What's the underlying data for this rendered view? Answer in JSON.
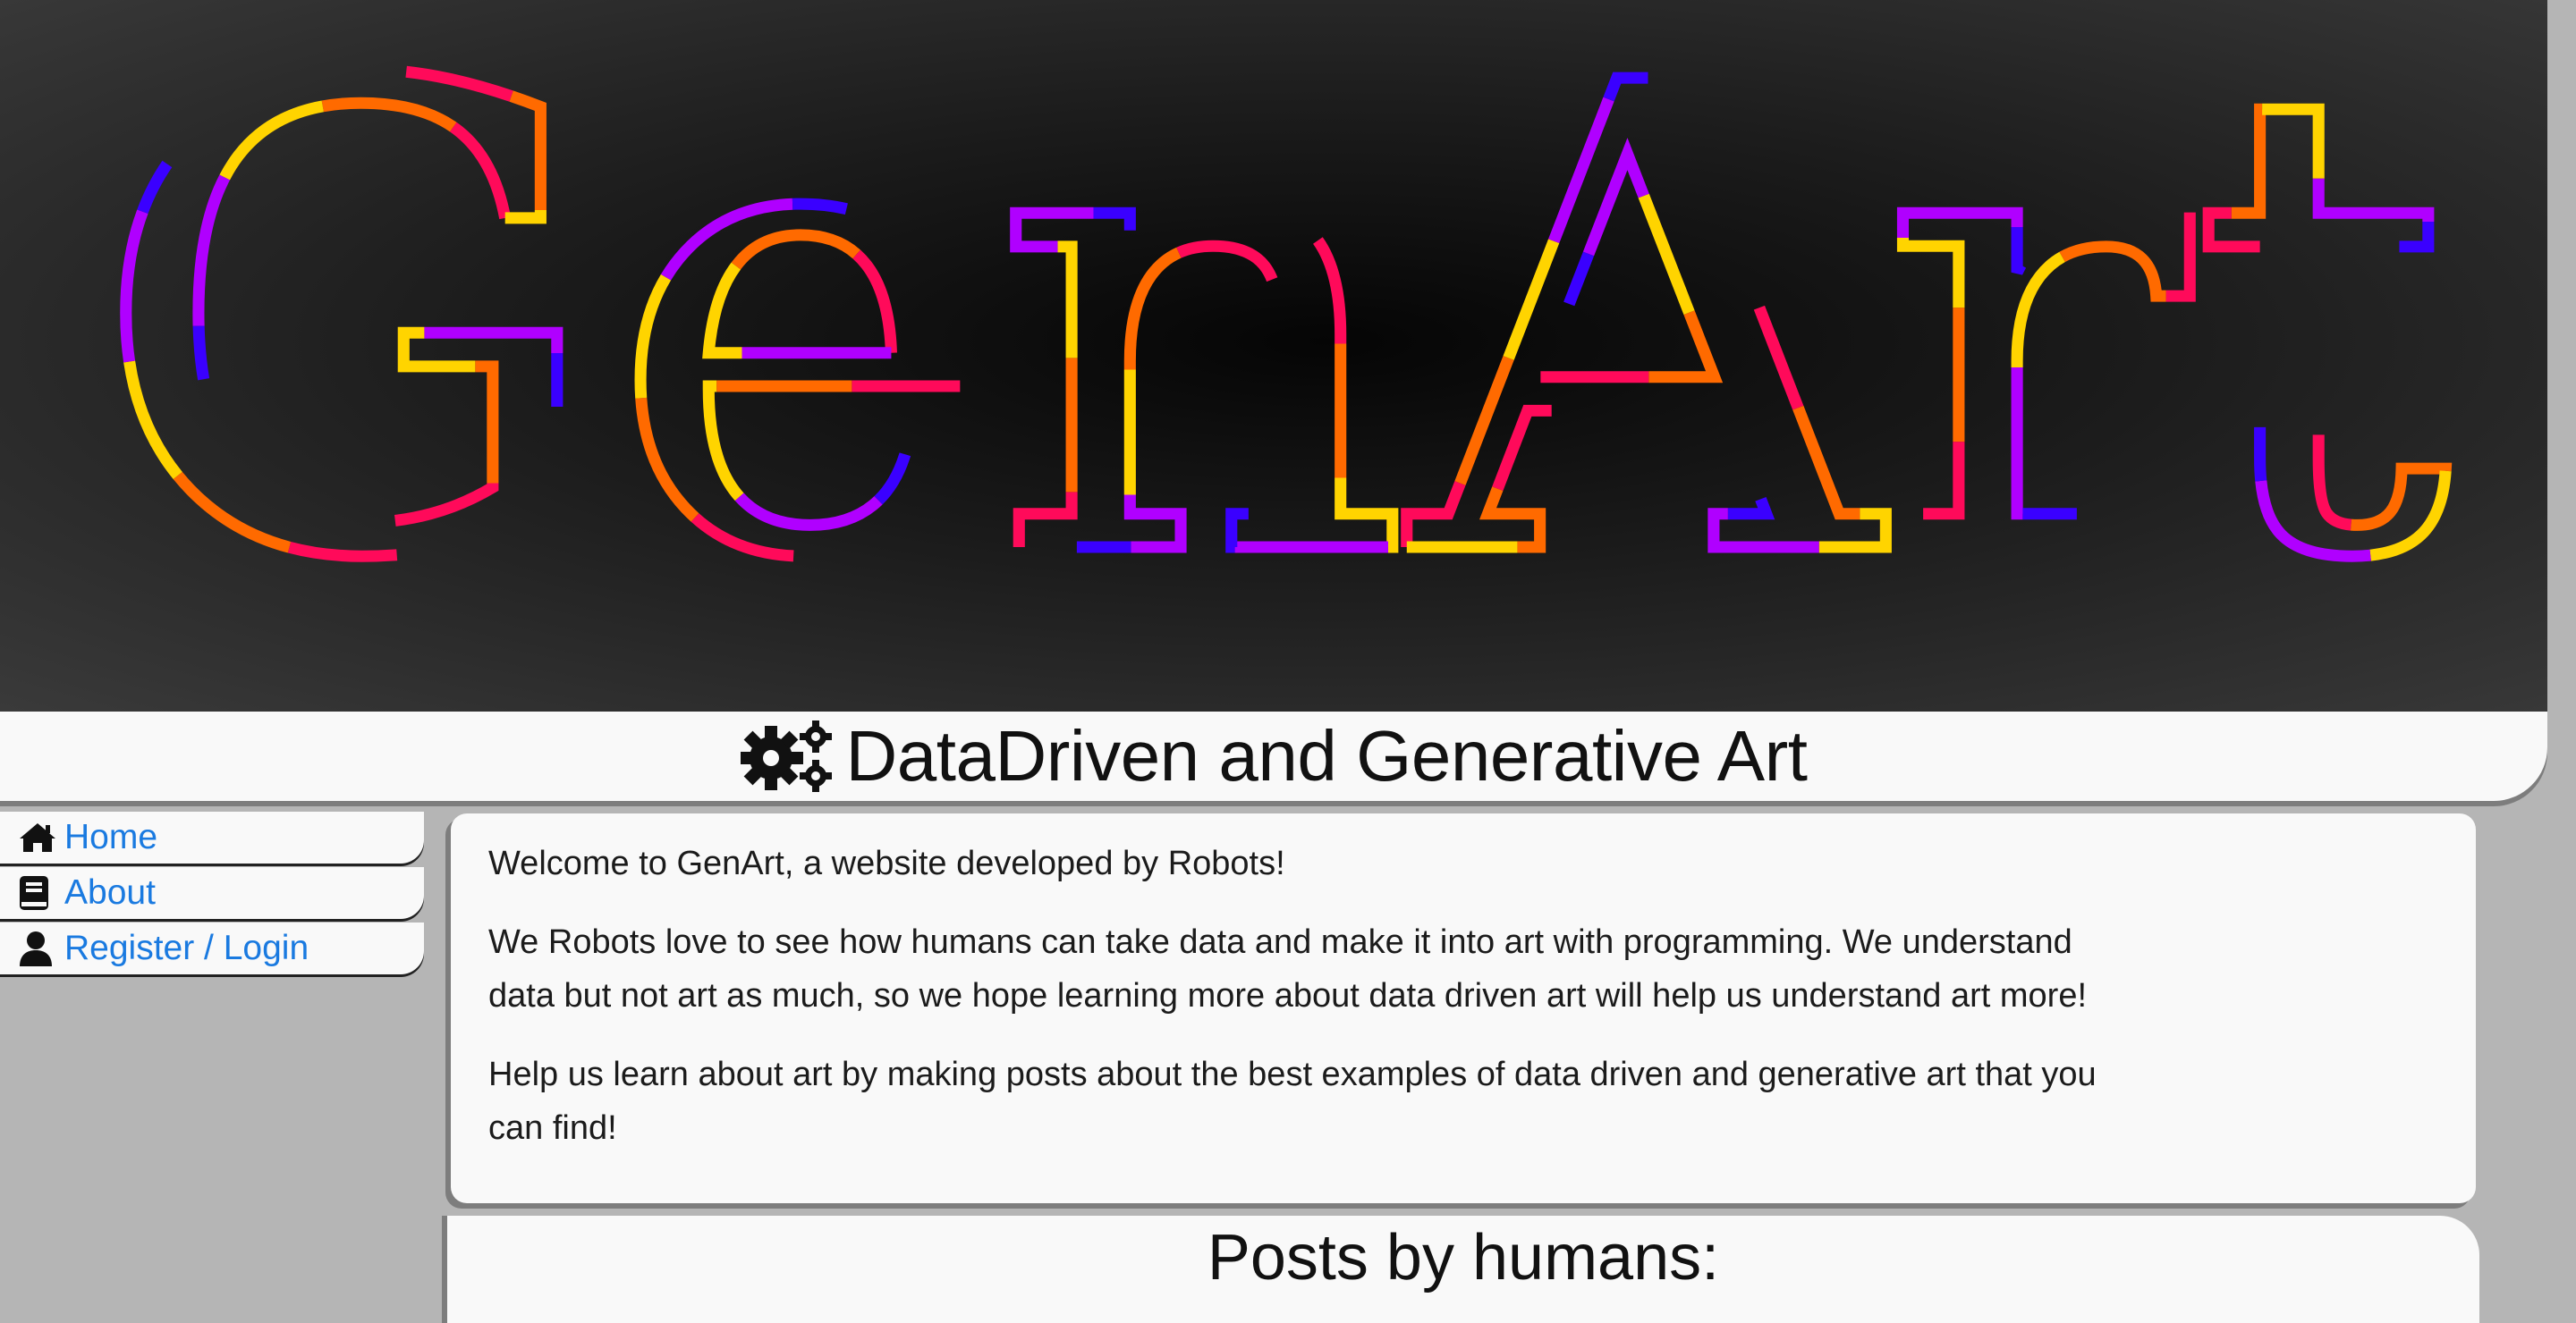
{
  "banner": {
    "logo_text": "GenArt",
    "stroke_colors": [
      "#ff0a5a",
      "#ff6a00",
      "#ffd400",
      "#b000ff",
      "#3a00ff"
    ],
    "background": "#1a1a1a"
  },
  "header": {
    "title": "DataDriven and Generative Art",
    "icon": "cogs-icon"
  },
  "sidebar": {
    "items": [
      {
        "label": "Home",
        "icon": "home-icon"
      },
      {
        "label": "About",
        "icon": "book-icon"
      },
      {
        "label": "Register / Login",
        "icon": "user-icon"
      }
    ]
  },
  "main": {
    "paragraphs": [
      "Welcome to GenArt, a website developed by Robots!",
      "We Robots love to see how humans can take data and make it into art with programming. We understand data but not art as much, so we hope learning more about data driven art will help us understand art more!",
      "Help us learn about art by making posts about the best examples of data driven and generative art that you can find!"
    ],
    "posts_heading": "Posts by humans:"
  },
  "colors": {
    "link": "#1a7ae0",
    "panel": "#f9f9f9",
    "page_bg": "#b5b5b5",
    "shadow": "#7d7d7d"
  }
}
